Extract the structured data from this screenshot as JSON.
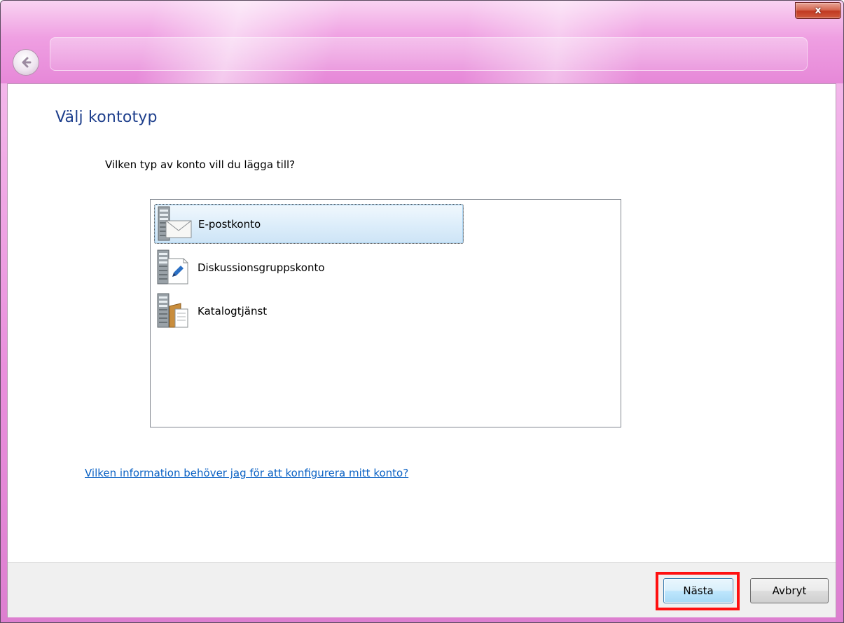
{
  "window": {
    "close_label": "x"
  },
  "dialog": {
    "heading": "Välj kontotyp",
    "question": "Vilken typ av konto vill du lägga till?",
    "account_types": [
      {
        "label": "E-postkonto",
        "icon": "email-server-icon",
        "selected": true
      },
      {
        "label": "Diskussionsgruppskonto",
        "icon": "newsgroup-server-icon",
        "selected": false
      },
      {
        "label": "Katalogtjänst",
        "icon": "directory-server-icon",
        "selected": false
      }
    ],
    "help_link": "Vilken information behöver jag för att konfigurera mitt konto?"
  },
  "buttons": {
    "next": "Nästa",
    "cancel": "Avbryt"
  },
  "colors": {
    "heading": "#1e3f8c",
    "link": "#0b62c4",
    "highlight": "#ff1010",
    "titlebar": "#ef9fe2"
  }
}
